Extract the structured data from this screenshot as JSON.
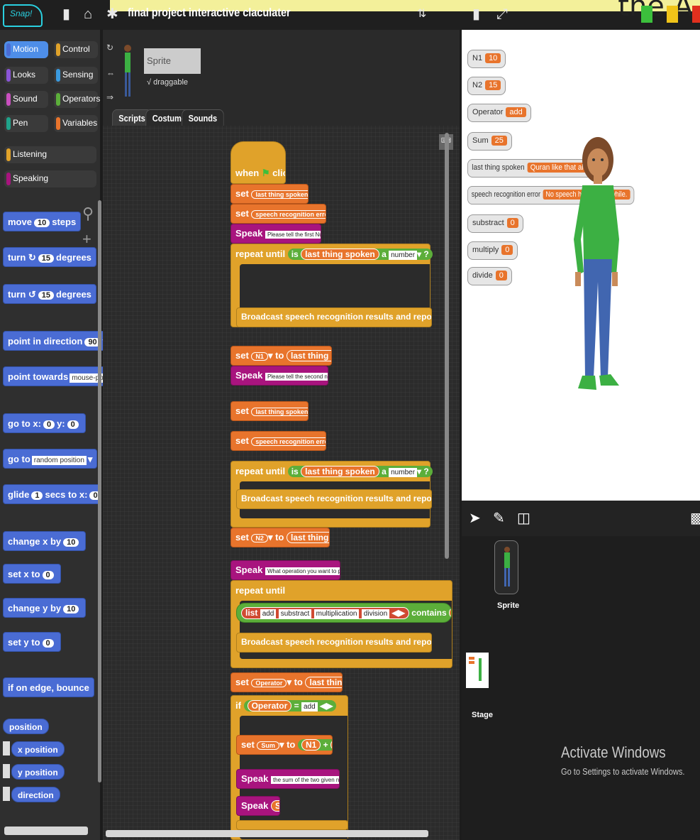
{
  "topbar": {
    "banner_text": "the A",
    "logo": "Snap!",
    "project_title": "final project interactive claculater"
  },
  "categories": [
    {
      "label": "Motion",
      "color": "#4a6cd4",
      "selected": true
    },
    {
      "label": "Control",
      "color": "#e0a22a"
    },
    {
      "label": "Looks",
      "color": "#8a55d7"
    },
    {
      "label": "Sensing",
      "color": "#3a9adf"
    },
    {
      "label": "Sound",
      "color": "#c94fbf"
    },
    {
      "label": "Operators",
      "color": "#5cae3a"
    },
    {
      "label": "Pen",
      "color": "#1fa38a"
    },
    {
      "label": "Variables",
      "color": "#e8742c"
    },
    {
      "label": "Listening",
      "color": "#e0a22a"
    },
    {
      "label": "Speaking",
      "color": "#a8147e"
    }
  ],
  "palette": {
    "move": {
      "a": "move",
      "n": "10",
      "b": "steps"
    },
    "turn_cw": {
      "a": "turn",
      "n": "15",
      "b": "degrees"
    },
    "turn_ccw": {
      "a": "turn",
      "n": "15",
      "b": "degrees"
    },
    "point_dir": {
      "a": "point in direction",
      "n": "90"
    },
    "point_towards": {
      "a": "point towards",
      "f": "mouse-pointer"
    },
    "goto_xy": {
      "a": "go to x:",
      "n1": "0",
      "b": "y:",
      "n2": "0"
    },
    "goto": {
      "a": "go to",
      "f": "random position"
    },
    "glide": {
      "a": "glide",
      "n1": "1",
      "b": "secs to x:",
      "n2": "0",
      "c": "y:",
      "n3": "0"
    },
    "change_x": {
      "a": "change x by",
      "n": "10"
    },
    "set_x": {
      "a": "set x to",
      "n": "0"
    },
    "change_y": {
      "a": "change y by",
      "n": "10"
    },
    "set_y": {
      "a": "set y to",
      "n": "0"
    },
    "bounce": "if on edge, bounce",
    "position": "position",
    "x_position": "x position",
    "y_position": "y position",
    "direction": "direction"
  },
  "sprite": {
    "name": "Sprite",
    "draggable_label": "draggable",
    "tabs": [
      "Scripts",
      "Costumes",
      "Sounds"
    ]
  },
  "script": {
    "when": "when",
    "clicked": "clicked",
    "set": "set",
    "to": "to",
    "speak": "Speak",
    "repeat_until": "repeat until",
    "is": "is",
    "a": "a",
    "q": "?",
    "number": "number",
    "broadcast": "Broadcast speech recognition results and report any errors",
    "last_thing_spoken": "last thing spoken",
    "var_last": "last thing spoken",
    "var_err": "speech recognition error",
    "prompt1": "Please tell the first Number",
    "prompt2": "Please tell the second number",
    "prompt3": "What operation you want to perform",
    "var_n1": "N1",
    "var_n2": "N2",
    "list": "list",
    "list_items": [
      "add",
      "substract",
      "multiplication",
      "division"
    ],
    "contains": "contains",
    "var_operator": "Operator",
    "if": "if",
    "eq": "=",
    "add": "add",
    "var_sum": "Sum",
    "plus": "+",
    "prompt4": "the sum of the two given numbers is",
    "sum": "Sum",
    "zero": "0"
  },
  "watchers": [
    {
      "name": "N1",
      "value": "10"
    },
    {
      "name": "N2",
      "value": "15"
    },
    {
      "name": "Operator",
      "value": "add"
    },
    {
      "name": "Sum",
      "value": "25"
    },
    {
      "name": "last thing spoken",
      "value": "Quran like that also"
    },
    {
      "name": "speech recognition error",
      "value": "No speech heard for a while."
    },
    {
      "name": "substract",
      "value": "0"
    },
    {
      "name": "multiply",
      "value": "0"
    },
    {
      "name": "divide",
      "value": "0"
    }
  ],
  "corral": {
    "sprite_label": "Sprite",
    "stage_label": "Stage",
    "activate_title": "Activate Windows",
    "activate_sub": "Go to Settings to activate Windows."
  }
}
